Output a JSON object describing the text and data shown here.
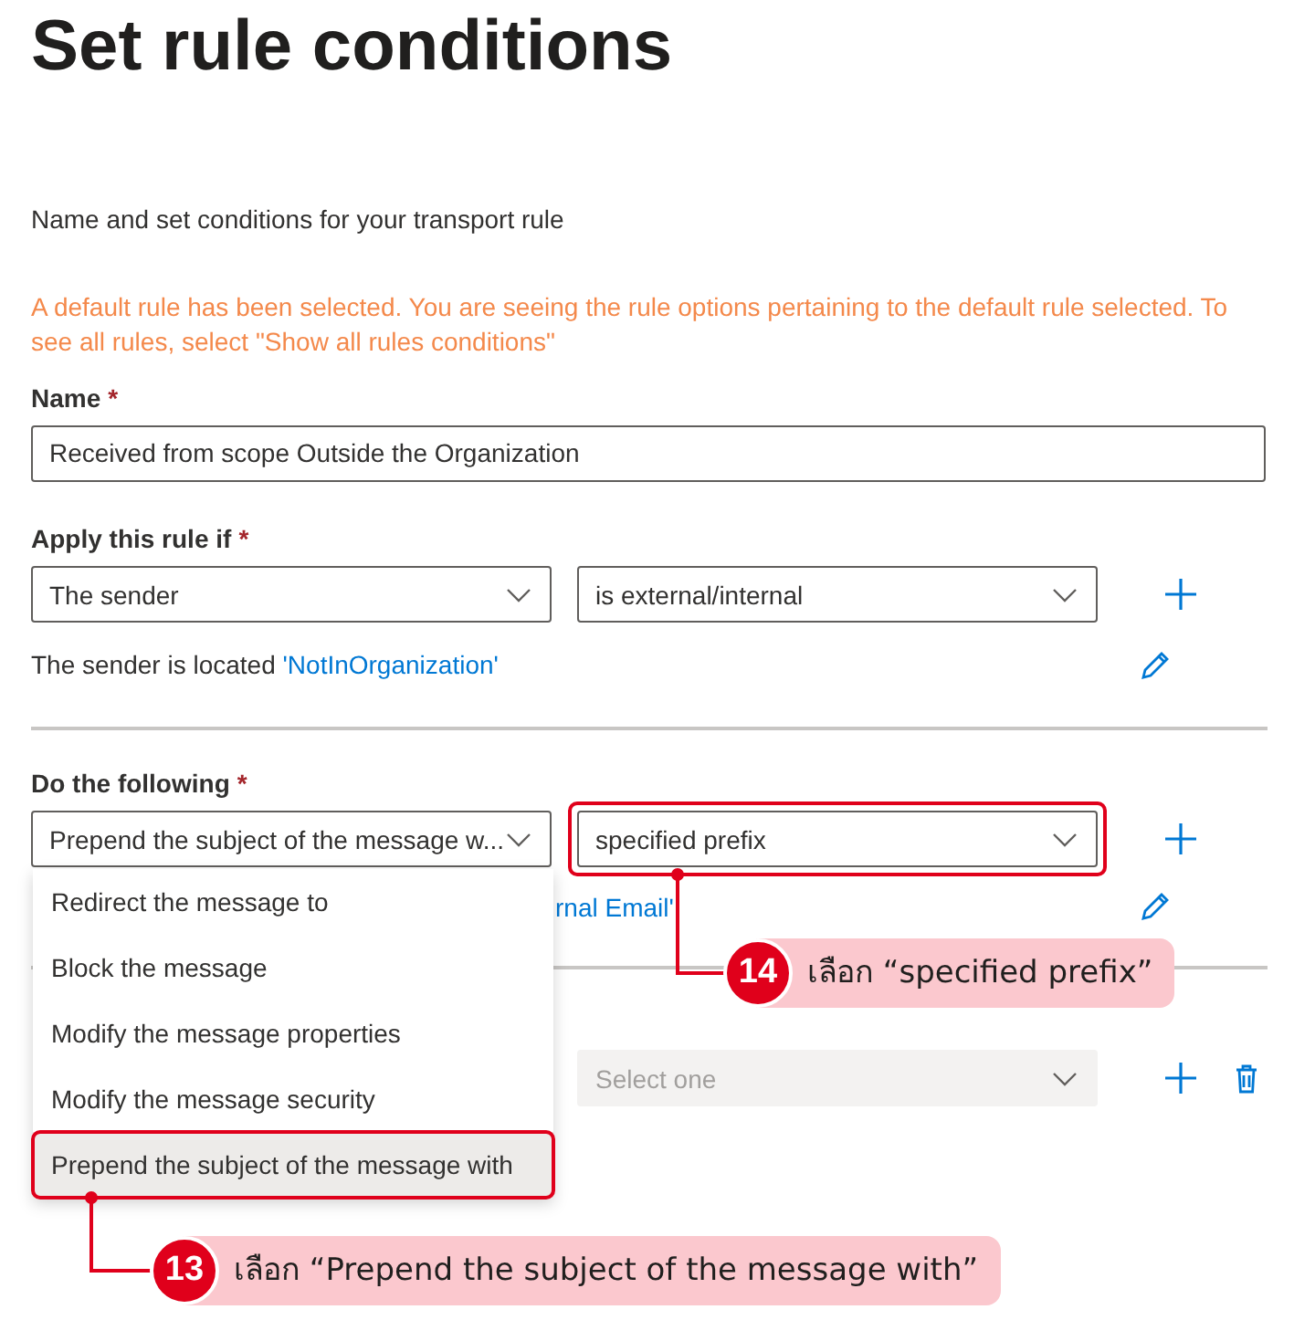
{
  "page": {
    "title": "Set rule conditions",
    "description": "Name and set conditions for your transport rule",
    "notice": "A default rule has been selected. You are seeing the rule options pertaining to the default rule selected. To see all rules, select \"Show all rules conditions\""
  },
  "name_field": {
    "label": "Name",
    "required_mark": "*",
    "value": "Received from scope Outside the Organization"
  },
  "condition": {
    "label": "Apply this rule if",
    "required_mark": "*",
    "selects": [
      {
        "value": "The sender",
        "disabled": false
      },
      {
        "value": "is external/internal",
        "disabled": false
      }
    ],
    "summary": "The sender is located ",
    "summary_link": "'NotInOrganization'"
  },
  "action": {
    "label": "Do the following",
    "required_mark": "*",
    "selects": [
      {
        "value": "Prepend the subject of the message w...",
        "disabled": false,
        "expanded": true
      },
      {
        "value": "specified prefix",
        "disabled": false,
        "highlighted": true
      }
    ],
    "summary_link": "rnal Email'"
  },
  "action_2": {
    "selects": [
      {
        "placeholder": "Select one",
        "disabled": true
      }
    ]
  },
  "dropdown": {
    "options": [
      {
        "label": "Redirect the message to",
        "selected": false
      },
      {
        "label": "Block the message",
        "selected": false
      },
      {
        "label": "Modify the message properties",
        "selected": false
      },
      {
        "label": "Modify the message security",
        "selected": false
      },
      {
        "label": "Prepend the subject of the message with",
        "selected": true,
        "highlighted": true
      }
    ]
  },
  "annotations": [
    {
      "number": "14",
      "text": "เลือก “specified prefix”"
    },
    {
      "number": "13",
      "text": "เลือก “Prepend the subject of the message with”"
    }
  ]
}
